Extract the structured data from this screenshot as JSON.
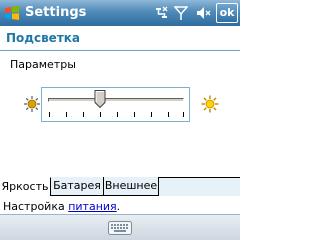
{
  "title_bar": {
    "title": "Settings",
    "ok_label": "ok",
    "icons": [
      "start-flag-icon",
      "connectivity-icon",
      "signal-icon",
      "volume-icon"
    ]
  },
  "page": {
    "heading": "Подсветка",
    "params_label": "Параметры"
  },
  "brightness": {
    "level": 0.38,
    "left_icon": "sun-dim-icon",
    "right_icon": "sun-bright-icon"
  },
  "tabs": [
    {
      "label": "Яркость",
      "active": true
    },
    {
      "label": "Батарея",
      "active": false
    },
    {
      "label": "Внешнее",
      "active": false
    }
  ],
  "footer": {
    "prefix": "Настройка ",
    "link": "питания",
    "suffix": "."
  },
  "menu_bar": {
    "icon": "keyboard-icon"
  },
  "colors": {
    "titlebar": "#2e6da0",
    "heading": "#1f76a8",
    "link": "#0000cc",
    "tab_inactive_bg": "#e6f1f8",
    "slider_frame": "#7ab0d0"
  }
}
